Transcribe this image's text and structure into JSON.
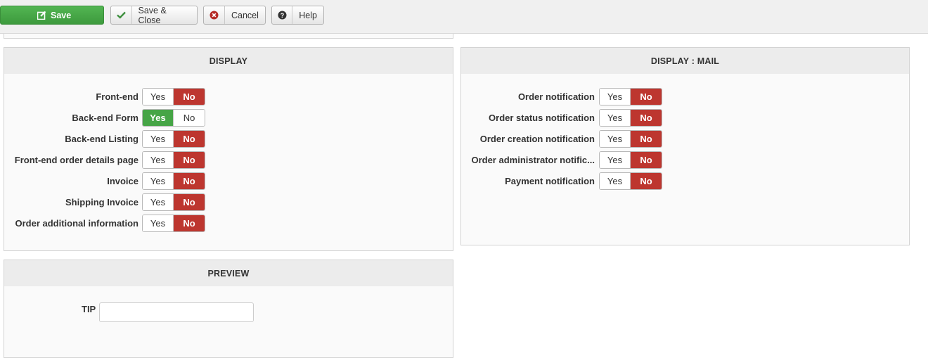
{
  "toolbar": {
    "save": "Save",
    "save_close": "Save & Close",
    "cancel": "Cancel",
    "help": "Help"
  },
  "display": {
    "title": "DISPLAY",
    "rows": [
      {
        "label": "Front-end",
        "yes": "Yes",
        "no": "No",
        "value": "No"
      },
      {
        "label": "Back-end Form",
        "yes": "Yes",
        "no": "No",
        "value": "Yes"
      },
      {
        "label": "Back-end Listing",
        "yes": "Yes",
        "no": "No",
        "value": "No"
      },
      {
        "label": "Front-end order details page",
        "yes": "Yes",
        "no": "No",
        "value": "No"
      },
      {
        "label": "Invoice",
        "yes": "Yes",
        "no": "No",
        "value": "No"
      },
      {
        "label": "Shipping Invoice",
        "yes": "Yes",
        "no": "No",
        "value": "No"
      },
      {
        "label": "Order additional information",
        "yes": "Yes",
        "no": "No",
        "value": "No"
      }
    ]
  },
  "display_mail": {
    "title": "DISPLAY : MAIL",
    "rows": [
      {
        "label": "Order notification",
        "yes": "Yes",
        "no": "No",
        "value": "No"
      },
      {
        "label": "Order status notification",
        "yes": "Yes",
        "no": "No",
        "value": "No"
      },
      {
        "label": "Order creation notification",
        "yes": "Yes",
        "no": "No",
        "value": "No"
      },
      {
        "label": "Order administrator notific...",
        "yes": "Yes",
        "no": "No",
        "value": "No"
      },
      {
        "label": "Payment notification",
        "yes": "Yes",
        "no": "No",
        "value": "No"
      }
    ]
  },
  "preview": {
    "title": "PREVIEW",
    "tip_label": "TIP",
    "tip_value": ""
  },
  "colors": {
    "save_green": "#46a546",
    "no_red": "#bd362f"
  }
}
